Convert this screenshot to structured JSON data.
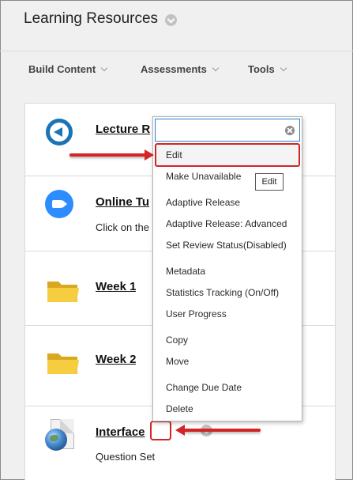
{
  "header": {
    "title": "Learning Resources",
    "title_menu_icon": "chevron-down-circle-icon"
  },
  "toolbar": {
    "items": [
      {
        "label": "Build Content"
      },
      {
        "label": "Assessments"
      },
      {
        "label": "Tools"
      }
    ]
  },
  "content_items": [
    {
      "title": "Lecture R",
      "icon": "lecture-play-icon",
      "description": ""
    },
    {
      "title": "Online Tu",
      "icon": "zoom-video-icon",
      "description": "Click on the"
    },
    {
      "title": "Week 1",
      "icon": "folder-icon",
      "description": ""
    },
    {
      "title": "Week 2",
      "icon": "folder-icon",
      "description": ""
    },
    {
      "title": "Interface",
      "icon": "test-document-icon",
      "description": "Question Set"
    }
  ],
  "context_menu": {
    "search": {
      "value": "",
      "placeholder": ""
    },
    "items": [
      {
        "label": "Edit"
      },
      {
        "label": "Make Unavailable"
      },
      {
        "label": "Adaptive Release"
      },
      {
        "label": "Adaptive Release: Advanced"
      },
      {
        "label": "Set Review Status(Disabled)"
      },
      {
        "label": "Metadata"
      },
      {
        "label": "Statistics Tracking (On/Off)"
      },
      {
        "label": "User Progress"
      },
      {
        "label": "Copy"
      },
      {
        "label": "Move"
      },
      {
        "label": "Change Due Date"
      },
      {
        "label": "Delete"
      }
    ],
    "tooltip": "Edit"
  },
  "colors": {
    "annotation_red": "#d42424",
    "focus_blue": "#2a7ed1",
    "lecture_blue": "#1b73b8",
    "zoom_blue": "#2d8cff"
  }
}
